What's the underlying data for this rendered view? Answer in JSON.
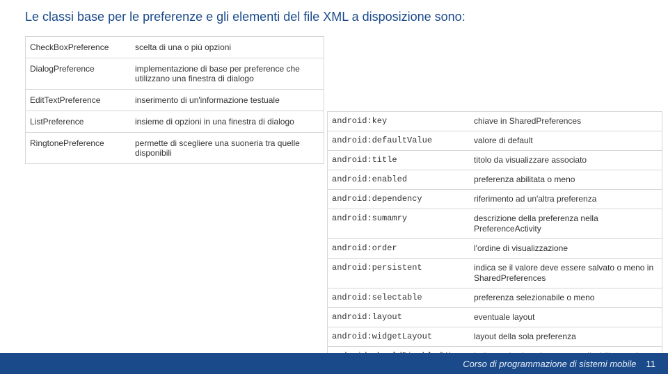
{
  "title": "Le classi base per le preferenze e gli elementi del file XML a disposizione sono:",
  "classes": [
    {
      "name": "CheckBoxPreference",
      "desc": "scelta di una o più opzioni"
    },
    {
      "name": "DialogPreference",
      "desc": "implementazione di base per preference che utilizzano una finestra di dialogo"
    },
    {
      "name": "EditTextPreference",
      "desc": "inserimento di un'informazione testuale"
    },
    {
      "name": "ListPreference",
      "desc": "insieme di opzioni in una finestra di dialogo"
    },
    {
      "name": "RingtonePreference",
      "desc": "permette di scegliere una suoneria tra quelle disponibili"
    }
  ],
  "attrs": [
    {
      "name": "android:key",
      "desc": "chiave in SharedPreferences"
    },
    {
      "name": "android:defaultValue",
      "desc": "valore di default"
    },
    {
      "name": "android:title",
      "desc": "titolo da visualizzare associato"
    },
    {
      "name": "android:enabled",
      "desc": "preferenza abilitata o meno"
    },
    {
      "name": "android:dependency",
      "desc": "riferimento ad un'altra preferenza"
    },
    {
      "name": "android:sumamry",
      "desc": "descrizione della preferenza nella PreferenceActivity"
    },
    {
      "name": "android:order",
      "desc": "l'ordine di visualizzazione"
    },
    {
      "name": "android:persistent",
      "desc": "indica se il valore deve essere salvato o meno in SharedPreferences"
    },
    {
      "name": "android:selectable",
      "desc": "preferenza selezionabile o meno"
    },
    {
      "name": "android:layout",
      "desc": "eventuale layout"
    },
    {
      "name": "android:widgetLayout",
      "desc": "layout della sola preferenza"
    },
    {
      "name": "android:shouldDisabledView",
      "desc": "indica se la view deve essere disabilitata nel caso di disabilitazione della preferenza"
    }
  ],
  "footer": {
    "course": "Corso di  programmazione di sistemi mobile",
    "page": "11"
  }
}
